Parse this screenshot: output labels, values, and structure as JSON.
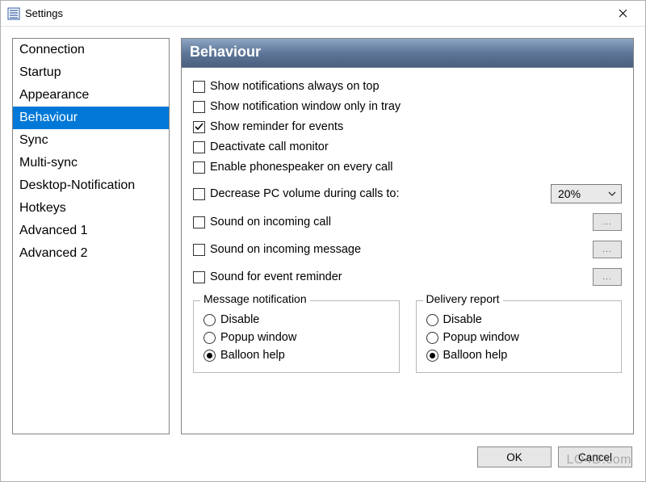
{
  "window": {
    "title": "Settings"
  },
  "sidebar": {
    "items": [
      {
        "label": "Connection",
        "selected": false
      },
      {
        "label": "Startup",
        "selected": false
      },
      {
        "label": "Appearance",
        "selected": false
      },
      {
        "label": "Behaviour",
        "selected": true
      },
      {
        "label": "Sync",
        "selected": false
      },
      {
        "label": "Multi-sync",
        "selected": false
      },
      {
        "label": "Desktop-Notification",
        "selected": false
      },
      {
        "label": "Hotkeys",
        "selected": false
      },
      {
        "label": "Advanced 1",
        "selected": false
      },
      {
        "label": "Advanced 2",
        "selected": false
      }
    ]
  },
  "panel": {
    "title": "Behaviour",
    "checks": {
      "always_on_top": {
        "label": "Show notifications always on top",
        "checked": false
      },
      "only_in_tray": {
        "label": "Show notification window only in tray",
        "checked": false
      },
      "reminder": {
        "label": "Show reminder for events",
        "checked": true
      },
      "deactivate_monitor": {
        "label": "Deactivate call monitor",
        "checked": false
      },
      "phonespeaker": {
        "label": "Enable phonespeaker on every call",
        "checked": false
      }
    },
    "volume": {
      "label": "Decrease PC volume during calls to:",
      "checked": false,
      "value": "20%"
    },
    "sounds": {
      "incoming_call": {
        "label": "Sound on incoming call",
        "checked": false,
        "browse": "..."
      },
      "incoming_message": {
        "label": "Sound on incoming message",
        "checked": false,
        "browse": "..."
      },
      "event_reminder": {
        "label": "Sound for event reminder",
        "checked": false,
        "browse": "..."
      }
    },
    "message_notification": {
      "legend": "Message notification",
      "options": {
        "disable": "Disable",
        "popup": "Popup window",
        "balloon": "Balloon help"
      },
      "selected": "balloon"
    },
    "delivery_report": {
      "legend": "Delivery report",
      "options": {
        "disable": "Disable",
        "popup": "Popup window",
        "balloon": "Balloon help"
      },
      "selected": "balloon"
    }
  },
  "footer": {
    "ok": "OK",
    "cancel": "Cancel"
  },
  "watermark": "LO4D.com"
}
